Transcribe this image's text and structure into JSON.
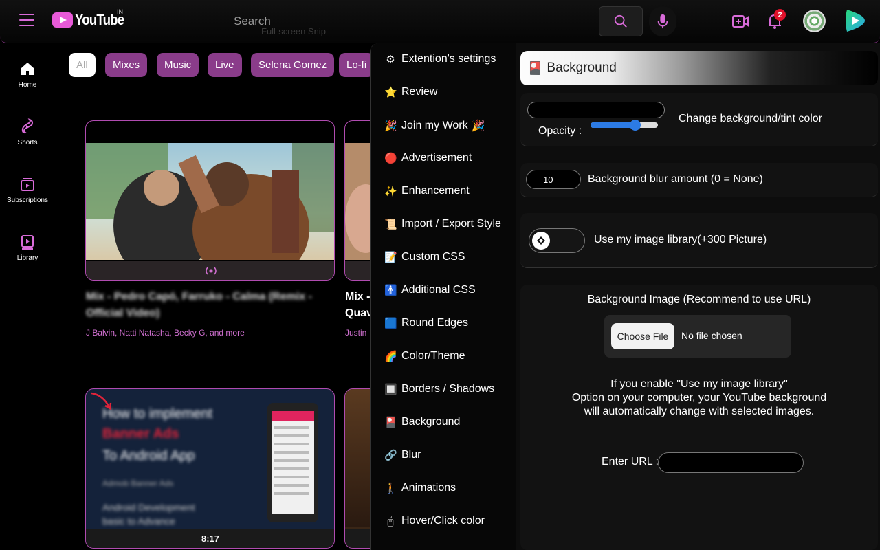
{
  "header": {
    "logo_text": "YouTube",
    "country": "IN",
    "search_placeholder": "Search",
    "ghost_text": "Full-screen Snip",
    "notification_count": "2"
  },
  "nav": [
    {
      "label": "Home",
      "icon": "home-icon"
    },
    {
      "label": "Shorts",
      "icon": "shorts-icon"
    },
    {
      "label": "Subscriptions",
      "icon": "subscriptions-icon"
    },
    {
      "label": "Library",
      "icon": "library-icon"
    }
  ],
  "chips": [
    "All",
    "Mixes",
    "Music",
    "Live",
    "Selena Gomez",
    "Lo-fi"
  ],
  "videos": [
    {
      "title": "Mix - Pedro Capó, Farruko - Calma (Remix - Official Video)",
      "channel": "J Balvin, Natti Natasha, Becky G, and more"
    },
    {
      "title_partial": "Mix -",
      "title_partial2": "Quav",
      "channel_partial": "Justin"
    },
    {
      "thumb_line1": "How to implement",
      "thumb_line2": "Banner Ads",
      "thumb_line3": "To Android App",
      "thumb_line4": "Admob Banner Ads",
      "thumb_line5": "Android Development",
      "thumb_line6": "basic to Advance",
      "duration": "8:17"
    }
  ],
  "extension": {
    "menu": [
      {
        "icon": "⚙",
        "label": "Extention's settings"
      },
      {
        "icon": "⭐",
        "label": "Review"
      },
      {
        "icon": "🎉",
        "label": "Join my Work",
        "suffix": "🎉"
      },
      {
        "icon": "🔴",
        "label": "Advertisement"
      },
      {
        "icon": "✨",
        "label": "Enhancement"
      },
      {
        "icon": "📜",
        "label": "Import / Export Style"
      },
      {
        "icon": "📝",
        "label": "Custom CSS"
      },
      {
        "icon": "🚹",
        "label": "Additional CSS"
      },
      {
        "icon": "🟦",
        "label": "Round Edges"
      },
      {
        "icon": "🌈",
        "label": "Color/Theme"
      },
      {
        "icon": "🔲",
        "label": "Borders / Shadows"
      },
      {
        "icon": "🎴",
        "label": "Background"
      },
      {
        "icon": "🔗",
        "label": "Blur"
      },
      {
        "icon": "🚶",
        "label": "Animations"
      },
      {
        "icon": "🖱",
        "label": "Hover/Click color"
      }
    ],
    "section_title": "Background",
    "section_icon": "🎴",
    "opacity_label": "Opacity :",
    "opacity_value": 0.66,
    "change_bg_label": "Change background/tint color",
    "blur_value": "10",
    "blur_label": "Background blur amount (0 = None)",
    "library_label": "Use my image library(+300 Picture)",
    "bg_image_label": "Background Image (Recommend to use URL)",
    "choose_file": "Choose File",
    "no_file": "No file chosen",
    "info_line1": "If you enable \"Use my image library\"",
    "info_line2": "Option on your computer, your YouTube background",
    "info_line3": "will automatically change with selected images.",
    "url_label": "Enter URL :"
  },
  "colors": {
    "accent": "#8a3c8a",
    "border_accent": "#b04bb0",
    "channel_text": "#d070d0"
  }
}
